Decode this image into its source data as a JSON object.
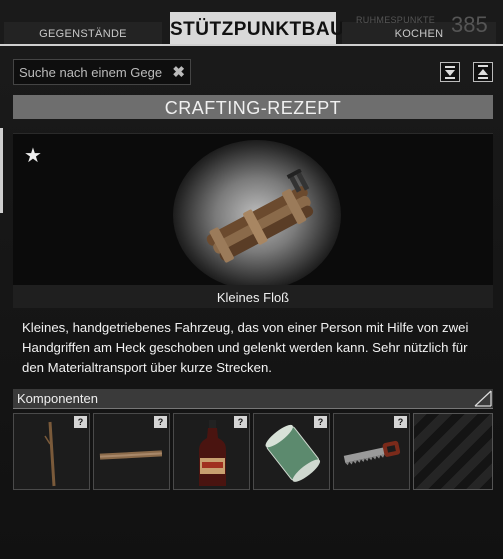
{
  "tabs": {
    "items": "GEGENSTÄNDE",
    "base_building": "STÜTZPUNKTBAU",
    "cooking": "KOCHEN"
  },
  "fame": {
    "label": "RUHMESPUNKTE",
    "value": "385"
  },
  "search": {
    "placeholder": "Suche nach einem Gegenstand",
    "value": "Suche nach einem Gege",
    "clear_glyph": "✖"
  },
  "recipe": {
    "header": "CRAFTING-REZEPT",
    "favorite_glyph": "★",
    "item_name": "Kleines Floß",
    "description": "Kleines, handgetriebenes Fahrzeug, das von einer Person mit Hilfe von zwei Handgriffen am Heck geschoben und gelenkt werden kann. Sehr nützlich für den Materialtransport über kurze Strecken."
  },
  "components": {
    "label": "Komponenten",
    "unknown_glyph": "?",
    "slots": [
      {
        "icon": "stick-icon"
      },
      {
        "icon": "plank-icon"
      },
      {
        "icon": "bottle-icon"
      },
      {
        "icon": "duct-tape-icon"
      },
      {
        "icon": "saw-icon"
      },
      {
        "icon": "empty-slot"
      }
    ]
  },
  "colors": {
    "active_tab_bg": "#d9d9d9",
    "header_bg": "#6e6e6e",
    "background": "#141414"
  }
}
